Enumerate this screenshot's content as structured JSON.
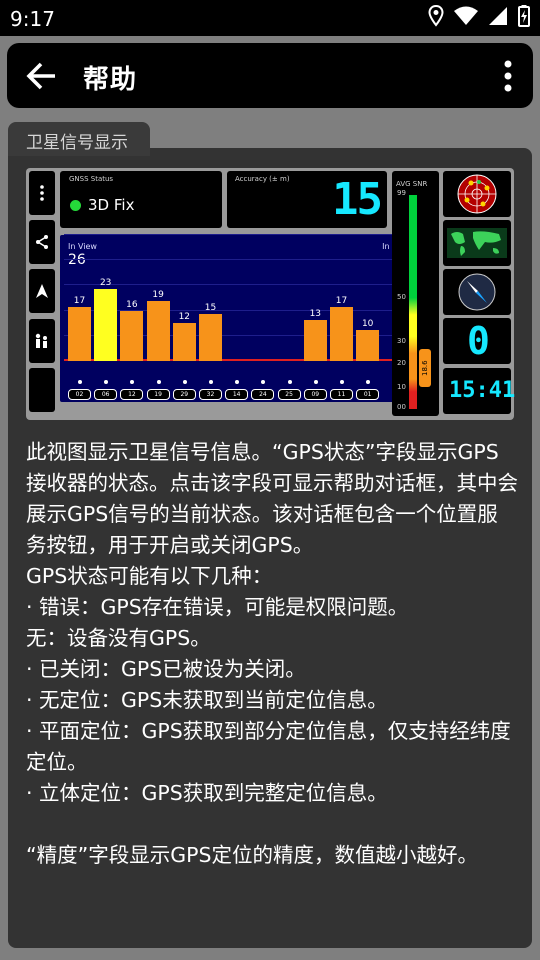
{
  "status_bar": {
    "time": "9:17"
  },
  "app_bar": {
    "title": "帮助"
  },
  "section": {
    "tab_label": "卫星信号显示"
  },
  "screenshot": {
    "gnss": {
      "label": "GNSS Status",
      "value": "3D Fix",
      "fix_color": "#25d93a"
    },
    "accuracy": {
      "label": "Accuracy (± m)",
      "value": "15"
    },
    "chart": {
      "in_view_label": "In View",
      "in_view": "26",
      "in_use_label": "In Use",
      "in_use": "6"
    },
    "snr": {
      "label": "AVG SNR",
      "ticks": [
        "99",
        "50",
        "30",
        "20",
        "10",
        "00"
      ],
      "avg": "18.6",
      "avg_value": 18.6
    },
    "big_digit": "0",
    "clock": "15:41"
  },
  "chart_data": {
    "type": "bar",
    "categories": [
      "02",
      "06",
      "12",
      "19",
      "29",
      "32",
      "14",
      "24",
      "25",
      "09",
      "11",
      "01"
    ],
    "values": [
      17,
      23,
      16,
      19,
      12,
      15,
      0,
      0,
      0,
      13,
      17,
      10
    ],
    "value_labels": [
      "17",
      "23",
      "16",
      "19",
      "12",
      "15",
      "",
      "",
      "",
      "13",
      "17",
      "10"
    ],
    "used": [
      false,
      true,
      false,
      false,
      false,
      false,
      false,
      false,
      false,
      false,
      false,
      false
    ],
    "ylim": [
      0,
      40
    ],
    "colors": {
      "default": "#f7931a",
      "used": "#ffff20"
    }
  },
  "help": {
    "paragraphs": [
      "此视图显示卫星信号信息。“GPS状态”字段显示GPS接收器的状态。点击该字段可显示帮助对话框，其中会展示GPS信号的当前状态。该对话框包含一个位置服务按钮，用于开启或关闭GPS。",
      "GPS状态可能有以下几种：",
      "· 错误：GPS存在错误，可能是权限问题。",
      "无：设备没有GPS。",
      "· 已关闭：GPS已被设为关闭。",
      "· 无定位：GPS未获取到当前定位信息。",
      "· 平面定位：GPS获取到部分定位信息，仅支持经纬度定位。",
      "· 立体定位：GPS获取到完整定位信息。",
      "",
      "“精度”字段显示GPS定位的精度，数值越小越好。"
    ]
  }
}
